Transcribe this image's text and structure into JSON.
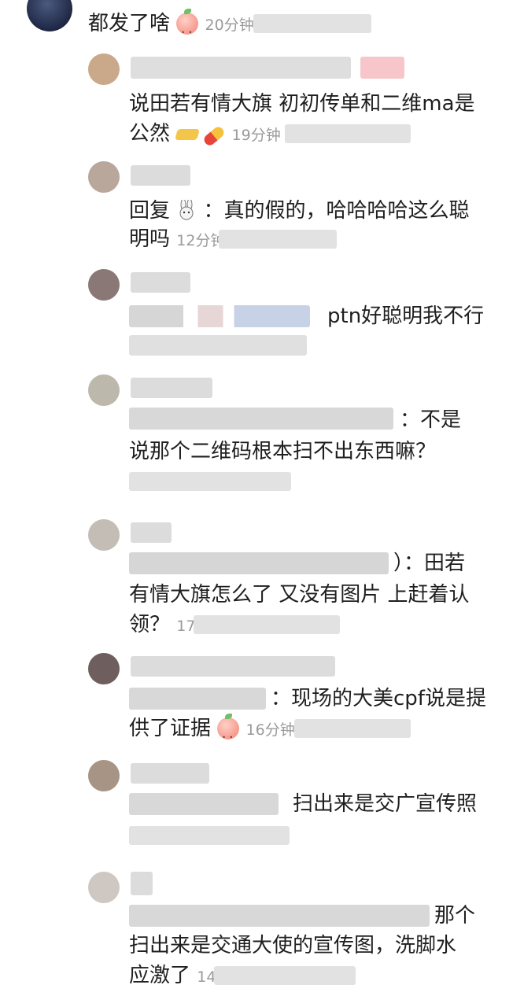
{
  "comments": [
    {
      "text": "都发了啥",
      "time": "20分钟"
    },
    {
      "line1": "说田若有情大旗 初初传单和二维ma是",
      "line2": "公然",
      "time": "19分钟"
    },
    {
      "prefix": "回复",
      "line1_rest": "：真的假的，哈哈哈哈这么聪",
      "line2": "明吗",
      "time": "12分钟"
    },
    {
      "text": "ptn好聪明我不行"
    },
    {
      "line1": "：不是",
      "line2": "说那个二维码根本扫不出东西嘛？"
    },
    {
      "line1": "）：田若",
      "line2": "有情大旗怎么了 又没有图片 上赶着认",
      "line3": "领？",
      "time": "17"
    },
    {
      "line1": "：现场的大美cpf说是提",
      "line2": "供了证据",
      "time": "16分钟"
    },
    {
      "text": "扫出来是交广宣传照"
    },
    {
      "line1": "那个",
      "line2": "扫出来是交通大使的宣传图，洗脚水",
      "line3": "应激了",
      "time": "14"
    }
  ],
  "emojis": [
    "peach-emoji",
    "butter-emoji",
    "pill-emoji",
    "bunny-emoji"
  ],
  "colors": {
    "text": "#1f1f1f",
    "time": "#9a9a9a",
    "blur": "#d8d8d8"
  }
}
